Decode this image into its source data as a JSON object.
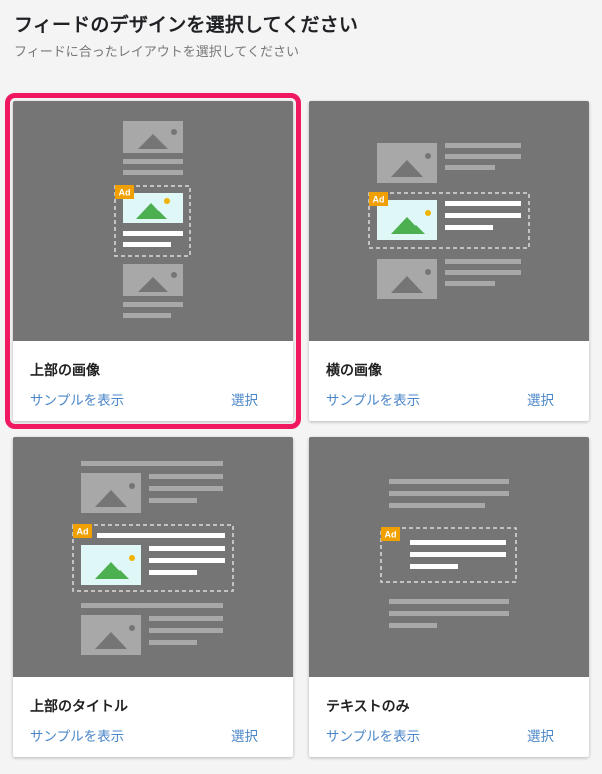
{
  "header": {
    "title": "フィードのデザインを選択してください",
    "subtitle": "フィードに合ったレイアウトを選択してください"
  },
  "ad_badge": "Ad",
  "colors": {
    "selected_outline": "#f0185f",
    "preview_bg": "#757575",
    "link": "#4a86c8",
    "ad_badge": "#f0a000",
    "image_placeholder": "#a8a8a8",
    "ad_image_bg": "#e0f7f7",
    "mountain": "#4caf50",
    "sun": "#f0b400"
  },
  "cards": [
    {
      "id": "top-image",
      "label": "上部の画像",
      "sample_link": "サンプルを表示",
      "select_link": "選択",
      "selected": true
    },
    {
      "id": "side-image",
      "label": "横の画像",
      "sample_link": "サンプルを表示",
      "select_link": "選択",
      "selected": false
    },
    {
      "id": "top-title",
      "label": "上部のタイトル",
      "sample_link": "サンプルを表示",
      "select_link": "選択",
      "selected": false
    },
    {
      "id": "text-only",
      "label": "テキストのみ",
      "sample_link": "サンプルを表示",
      "select_link": "選択",
      "selected": false
    }
  ]
}
